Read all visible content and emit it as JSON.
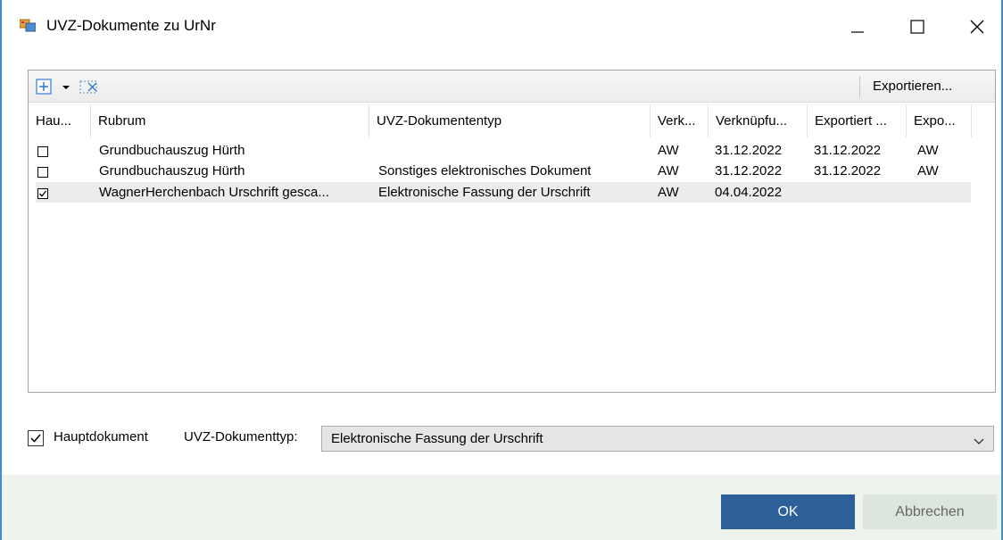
{
  "window": {
    "title": "UVZ-Dokumente zu UrNr"
  },
  "toolbar": {
    "add_icon": "add-document-icon",
    "dropdown_icon": "dropdown-arrow-icon",
    "delete_icon": "delete-icon",
    "export_label": "Exportieren..."
  },
  "grid": {
    "columns": [
      "Hau...",
      "Rubrum",
      "UVZ-Dokumententyp",
      "Verk...",
      "Verknüpfu...",
      "Exportiert ...",
      "Expo..."
    ],
    "rows": [
      {
        "checked": false,
        "rubrum": "Grundbuchauszug Hürth",
        "typ": "",
        "verk": "AW",
        "verknuepft": "31.12.2022",
        "exportiert": "31.12.2022",
        "expo": "AW"
      },
      {
        "checked": false,
        "rubrum": "Grundbuchauszug Hürth",
        "typ": "Sonstiges elektronisches Dokument",
        "verk": "AW",
        "verknuepft": "31.12.2022",
        "exportiert": "31.12.2022",
        "expo": "AW"
      },
      {
        "checked": true,
        "rubrum": "WagnerHerchenbach Urschrift gesca...",
        "typ": "Elektronische Fassung der Urschrift",
        "verk": "AW",
        "verknuepft": "04.04.2022",
        "exportiert": "",
        "expo": ""
      }
    ]
  },
  "form": {
    "hauptdokument_checked": true,
    "hauptdokument_label": "Hauptdokument",
    "typ_label": "UVZ-Dokumenttyp:",
    "typ_value": "Elektronische Fassung der Urschrift"
  },
  "buttons": {
    "ok": "OK",
    "cancel": "Abbrechen"
  },
  "colors": {
    "accent": "#2d5f99",
    "window_border": "#3c8fd6",
    "footer_bg": "#eef3ee"
  }
}
